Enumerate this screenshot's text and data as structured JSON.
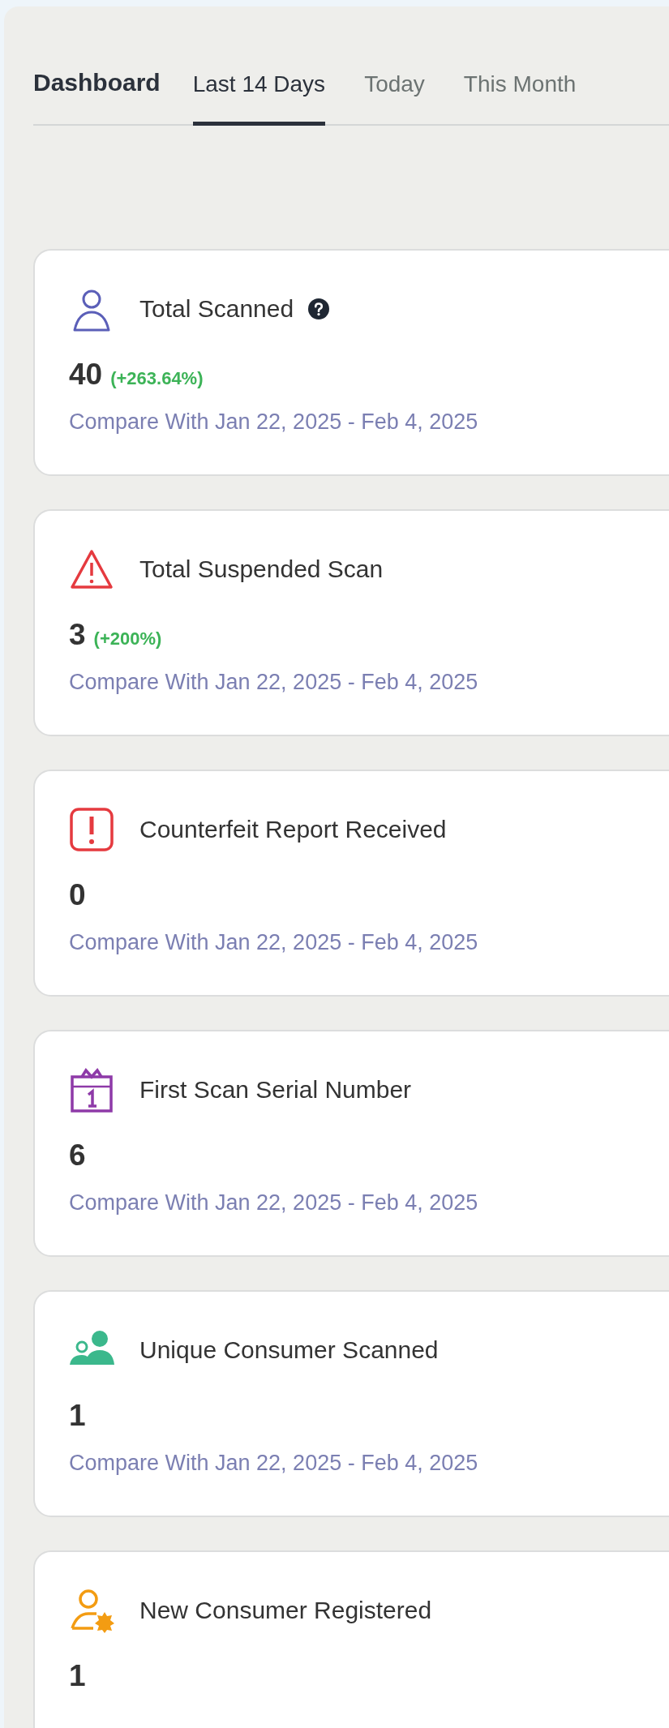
{
  "header": {
    "title": "Dashboard"
  },
  "tabs": [
    {
      "label": "Last 14 Days",
      "selected": true
    },
    {
      "label": "Today",
      "selected": false
    },
    {
      "label": "This Month",
      "selected": false
    }
  ],
  "cards": [
    {
      "kind": "person",
      "title": "Total Scanned",
      "help": true,
      "value": "40",
      "change": "(+263.64%)",
      "compare": "Compare With Jan 22, 2025 - Feb 4, 2025"
    },
    {
      "kind": "warning",
      "title": "Total Suspended Scan",
      "help": false,
      "value": "3",
      "change": "(+200%)",
      "compare": "Compare With Jan 22, 2025 - Feb 4, 2025"
    },
    {
      "kind": "alert",
      "title": "Counterfeit Report Received",
      "help": false,
      "value": "0",
      "compare": "Compare With Jan 22, 2025 - Feb 4, 2025"
    },
    {
      "kind": "calendar",
      "title": "First Scan Serial Number",
      "help": false,
      "value": "6",
      "compare": "Compare With Jan 22, 2025 - Feb 4, 2025"
    },
    {
      "kind": "users",
      "title": "Unique Consumer Scanned",
      "help": false,
      "value": "1",
      "compare": "Compare With Jan 22, 2025 - Feb 4, 2025"
    },
    {
      "kind": "newuser",
      "title": "New Consumer Registered",
      "help": false,
      "value": "1"
    }
  ]
}
